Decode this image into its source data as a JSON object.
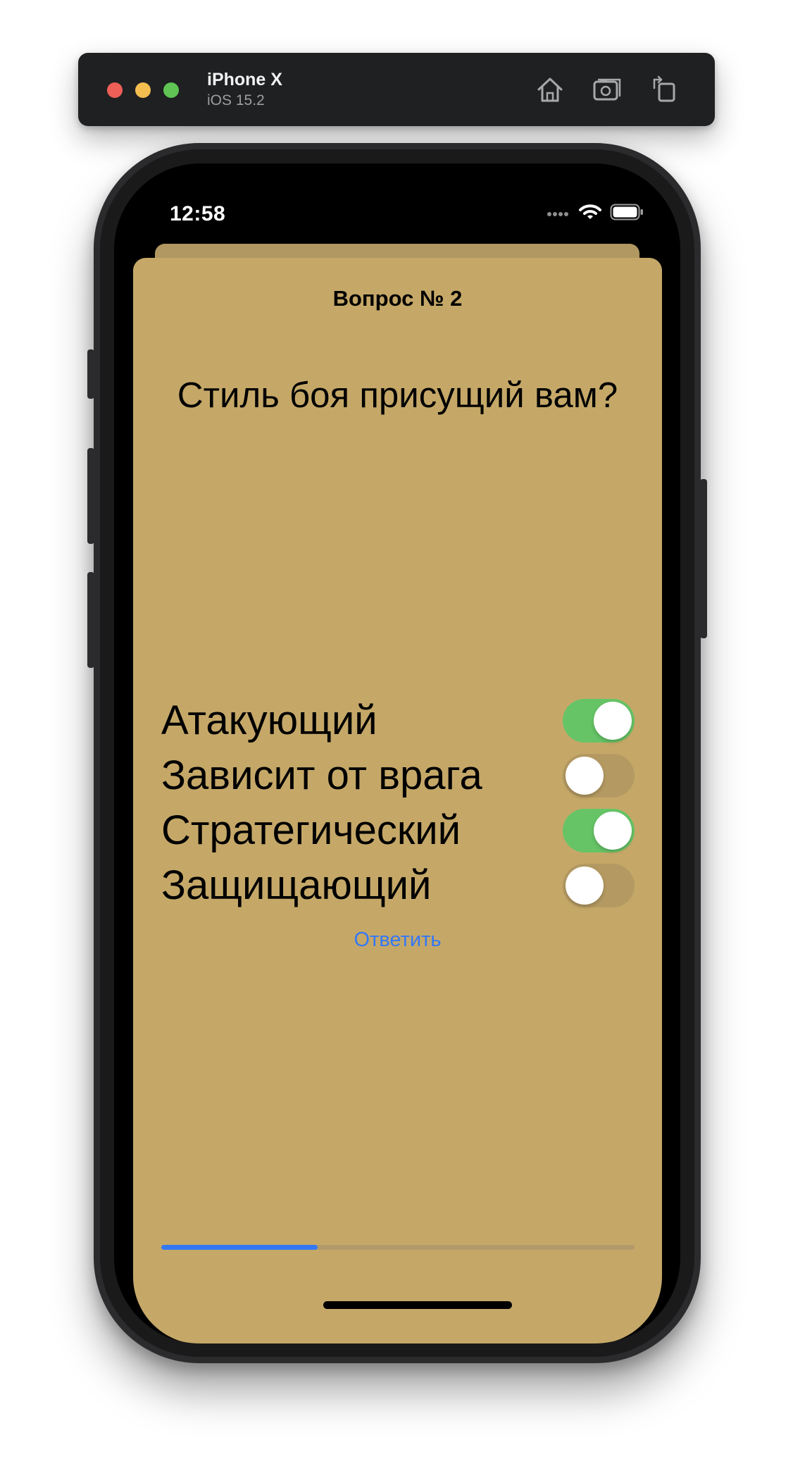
{
  "simulator": {
    "device_name": "iPhone X",
    "os_version": "iOS 15.2",
    "buttons": [
      {
        "icon": "home-icon"
      },
      {
        "icon": "screenshot-icon"
      },
      {
        "icon": "rotate-icon"
      }
    ]
  },
  "status_bar": {
    "time": "12:58",
    "icons": [
      "cellular-signal-icon",
      "wifi-icon",
      "battery-icon"
    ]
  },
  "quiz": {
    "question_number": "Вопрос № 2",
    "question_text": "Стиль боя присущий вам?",
    "options": [
      {
        "label": "Атакующий",
        "enabled": true
      },
      {
        "label": "Зависит от врага",
        "enabled": false
      },
      {
        "label": "Стратегический",
        "enabled": true
      },
      {
        "label": "Защищающий",
        "enabled": false
      }
    ],
    "answer_button": "Ответить",
    "progress": 0.33
  },
  "colors": {
    "card_background": "#c5a868",
    "accent_blue": "#3478f6",
    "toggle_on": "#66c466",
    "toggle_off": "#b49a62"
  }
}
